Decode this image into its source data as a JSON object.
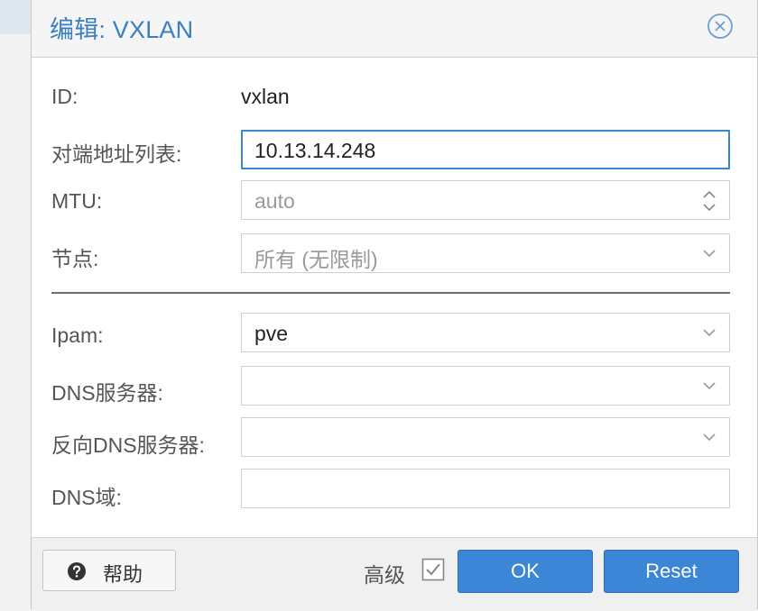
{
  "dialog": {
    "title": "编辑: VXLAN"
  },
  "form": {
    "id": {
      "label": "ID:",
      "value": "vxlan"
    },
    "peers": {
      "label": "对端地址列表:",
      "value": "10.13.14.248"
    },
    "mtu": {
      "label": "MTU:",
      "placeholder": "auto"
    },
    "nodes": {
      "label": "节点:",
      "value": "所有 (无限制)"
    },
    "ipam": {
      "label": "Ipam:",
      "value": "pve"
    },
    "dns": {
      "label": "DNS服务器:",
      "value": ""
    },
    "reverse_dns": {
      "label": "反向DNS服务器:",
      "value": ""
    },
    "dns_zone": {
      "label": "DNS域:",
      "value": ""
    }
  },
  "footer": {
    "help_label": "帮助",
    "advanced_label": "高级",
    "advanced_checked": true,
    "ok_label": "OK",
    "reset_label": "Reset"
  },
  "colors": {
    "accent": "#3a7fc2",
    "primary_button": "#3b86d6",
    "focus_border": "#3a87d0"
  },
  "icons": {
    "close": "close-circle-icon",
    "help": "question-circle-icon",
    "dropdown": "chevron-down-icon",
    "spinner": "spinner-arrows-icon",
    "checkbox": "checkbox-checked-icon"
  }
}
